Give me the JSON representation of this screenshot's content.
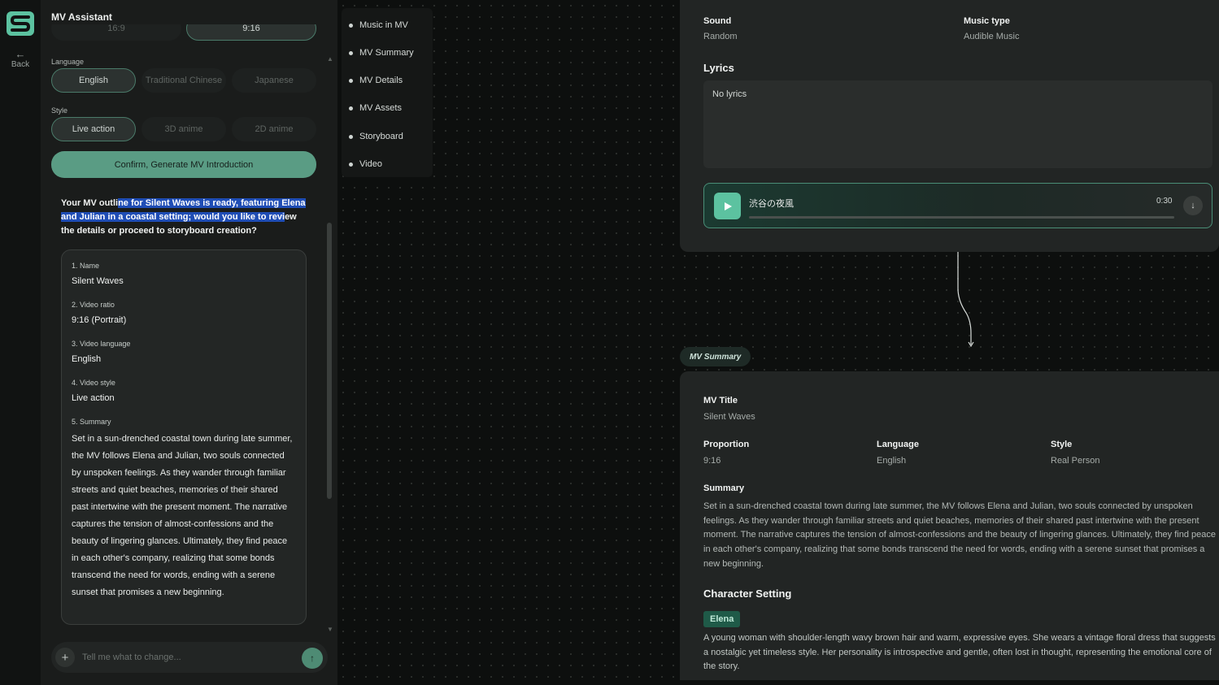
{
  "app": {
    "back_label": "Back",
    "brand_color": "#5cc2a0"
  },
  "assistant": {
    "title": "MV Assistant",
    "ratio_options": [
      "16:9",
      "9:16"
    ],
    "language_label": "Language",
    "language_options": [
      "English",
      "Traditional Chinese",
      "Japanese"
    ],
    "language_selected": "English",
    "style_label": "Style",
    "style_options": [
      "Live action",
      "3D anime",
      "2D anime"
    ],
    "style_selected": "Live action",
    "confirm_label": "Confirm, Generate MV Introduction",
    "message": {
      "plain_start": "Your MV outli",
      "highlighted": "ne for Silent Waves is ready, featuring Elena and Julian in a coastal setting; would you like to revi",
      "plain_end": "ew the details or proceed to storyboard creation?"
    },
    "card": {
      "fields": [
        {
          "label": "1. Name",
          "value": "Silent Waves"
        },
        {
          "label": "2. Video ratio",
          "value": "9:16 (Portrait)"
        },
        {
          "label": "3. Video language",
          "value": "English"
        },
        {
          "label": "4. Video style",
          "value": "Live action"
        }
      ],
      "summary_label": "5. Summary",
      "summary": "Set in a sun-drenched coastal town during late summer, the MV follows Elena and Julian, two souls connected by unspoken feelings. As they wander through familiar streets and quiet beaches, memories of their shared past intertwine with the present moment. The narrative captures the tension of almost-confessions and the beauty of lingering glances. Ultimately, they find peace in each other's company, realizing that some bonds transcend the need for words, ending with a serene sunset that promises a new beginning."
    },
    "input": {
      "placeholder": "Tell me what to change..."
    }
  },
  "nav": {
    "items": [
      "Music in MV",
      "MV Summary",
      "MV Details",
      "MV Assets",
      "Storyboard",
      "Video"
    ]
  },
  "music_node": {
    "sound_label": "Sound",
    "sound_value": "Random",
    "music_type_label": "Music type",
    "music_type_value": "Audible Music",
    "lyrics_label": "Lyrics",
    "lyrics_value": "No lyrics",
    "player": {
      "track": "渋谷の夜風",
      "time": "0:30",
      "progress": 0
    }
  },
  "summary_node": {
    "tag": "MV Summary",
    "title_label": "MV Title",
    "title_value": "Silent Waves",
    "proportion_label": "Proportion",
    "proportion_value": "9:16",
    "language_label": "Language",
    "language_value": "English",
    "style_label": "Style",
    "style_value": "Real Person",
    "summary_label": "Summary",
    "summary": "Set in a sun-drenched coastal town during late summer, the MV follows Elena and Julian, two souls connected by unspoken feelings. As they wander through familiar streets and quiet beaches, memories of their shared past intertwine with the present moment. The narrative captures the tension of almost-confessions and the beauty of lingering glances. Ultimately, they find peace in each other's company, realizing that some bonds transcend the need for words, ending with a serene sunset that promises a new beginning.",
    "character_label": "Character Setting",
    "character_name": "Elena",
    "character_desc": "A young woman with shoulder-length wavy brown hair and warm, expressive eyes. She wears a vintage floral dress that suggests a nostalgic yet timeless style. Her personality is introspective and gentle, often lost in thought, representing the emotional core of the story."
  }
}
